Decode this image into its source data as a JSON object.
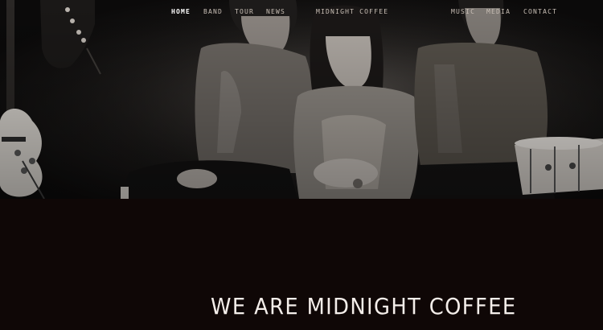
{
  "nav": {
    "left_items": [
      {
        "label": "HOME",
        "active": true
      },
      {
        "label": "BAND",
        "active": false
      },
      {
        "label": "TOUR",
        "active": false
      },
      {
        "label": "NEWS",
        "active": false
      }
    ],
    "brand": "MIDNIGHT COFFEE",
    "right_items": [
      {
        "label": "MUSIC"
      },
      {
        "label": "MEDIA"
      },
      {
        "label": "CONTACT"
      }
    ]
  },
  "hero": {
    "image_subject": "band-photo"
  },
  "main": {
    "headline": "WE ARE MIDNIGHT COFFEE"
  },
  "colors": {
    "background": "#0f0706",
    "brand": "#d8b9a8",
    "nav_text": "#c9bfb6",
    "headline": "#f4eeea"
  }
}
